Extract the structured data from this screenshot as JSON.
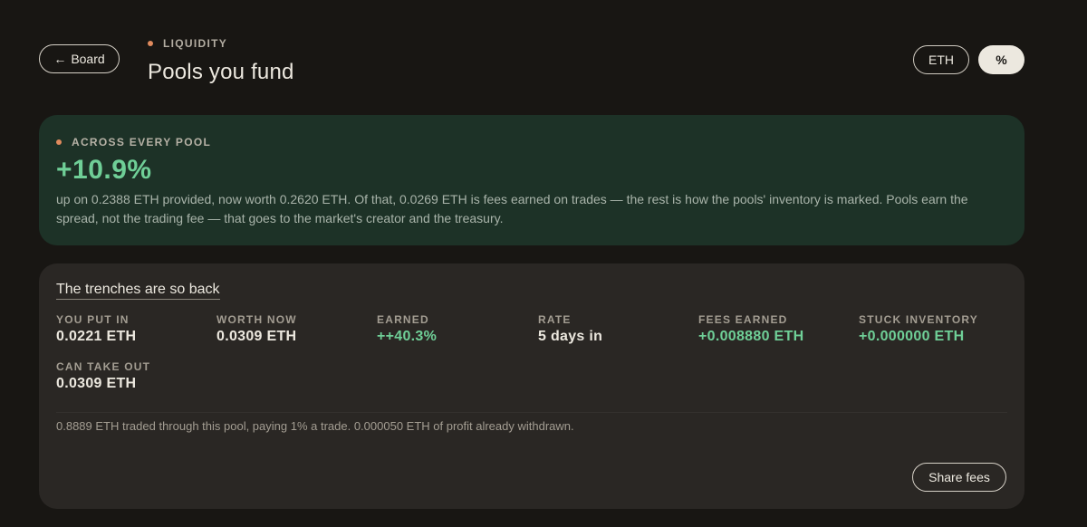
{
  "header": {
    "back_label": "Board",
    "eyebrow": "LIQUIDITY",
    "title": "Pools you fund",
    "toggle_eth": "ETH",
    "toggle_pct": "%"
  },
  "summary": {
    "eyebrow": "ACROSS EVERY POOL",
    "value": "+10.9%",
    "description": "up on 0.2388 ETH provided, now worth 0.2620 ETH. Of that, 0.0269 ETH is fees earned on trades — the rest is how the pools' inventory is marked. Pools earn the spread, not the trading fee — that goes to the market's creator and the treasury."
  },
  "pool": {
    "name": "The trenches are so back",
    "stats": [
      {
        "label": "YOU PUT IN",
        "value": "0.0221 ETH"
      },
      {
        "label": "WORTH NOW",
        "value": "0.0309 ETH"
      },
      {
        "label": "EARNED",
        "value": "++40.3%"
      },
      {
        "label": "RATE",
        "value": "5 days in"
      },
      {
        "label": "FEES EARNED",
        "value": "+0.008880 ETH"
      },
      {
        "label": "STUCK INVENTORY",
        "value": "+0.000000 ETH"
      },
      {
        "label": "CAN TAKE OUT",
        "value": "0.0309 ETH"
      }
    ],
    "note": "0.8889 ETH traded through this pool, paying 1% a trade. 0.000050 ETH of profit already withdrawn.",
    "share_label": "Share fees"
  },
  "colors": {
    "background": "#181613",
    "accent_green": "#6fcf97",
    "accent_orange": "#e08a5d",
    "summary_card": "#1d3227",
    "pool_card": "#2a2724"
  },
  "icons": {
    "back": "arrow-left-icon",
    "eyebrow": "dot-icon"
  }
}
